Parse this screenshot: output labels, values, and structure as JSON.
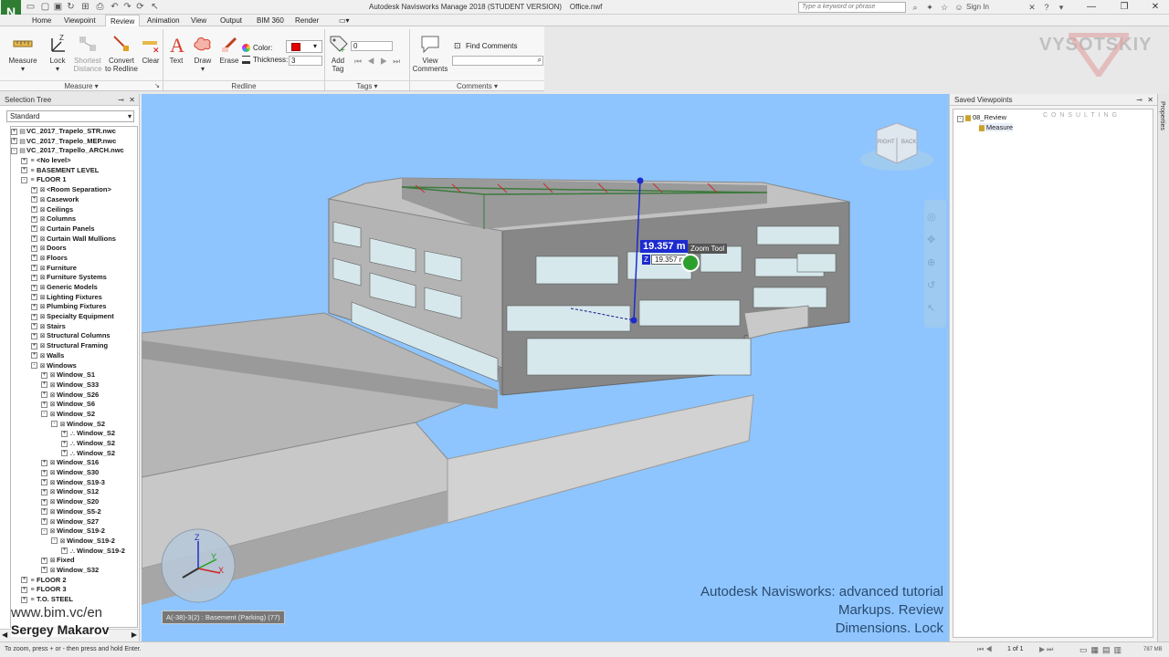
{
  "window": {
    "title": "Autodesk Navisworks Manage 2018 (STUDENT VERSION)    Office.nwf",
    "search_placeholder": "Type a keyword or phrase",
    "signin": "Sign In",
    "app_logo": "N"
  },
  "tabs": [
    "Home",
    "Viewpoint",
    "Review",
    "Animation",
    "View",
    "Output",
    "BIM 360",
    "Render"
  ],
  "active_tab": "Review",
  "ribbon": {
    "measure": {
      "measure": "Measure",
      "lock": "Lock",
      "shortest": "Shortest\nDistance",
      "convert": "Convert\nto Redline",
      "clear": "Clear",
      "panel": "Measure"
    },
    "redline": {
      "text": "Text",
      "draw": "Draw",
      "erase": "Erase",
      "color_label": "Color:",
      "thickness_label": "Thickness:",
      "thickness_value": "3",
      "color": "#e00000",
      "panel": "Redline"
    },
    "tags": {
      "add_tag": "Add\nTag",
      "tag_value": "0",
      "panel": "Tags"
    },
    "comments": {
      "view_comments": "View\nComments",
      "find_comments": "Find Comments",
      "panel": "Comments"
    }
  },
  "selection_tree": {
    "title": "Selection Tree",
    "mode": "Standard",
    "items": [
      {
        "d": 0,
        "t": "VC_2017_Trapelo_STR.nwc",
        "e": "+",
        "g": "file"
      },
      {
        "d": 0,
        "t": "VC_2017_Trapelo_MEP.nwc",
        "e": "+",
        "g": "file"
      },
      {
        "d": 0,
        "t": "VC_2017_Trapello_ARCH.nwc",
        "e": "-",
        "g": "file"
      },
      {
        "d": 1,
        "t": "<No level>",
        "e": "+",
        "g": "level"
      },
      {
        "d": 1,
        "t": "BASEMENT LEVEL",
        "e": "+",
        "g": "level"
      },
      {
        "d": 1,
        "t": "FLOOR 1",
        "e": "-",
        "g": "level"
      },
      {
        "d": 2,
        "t": "<Room Separation>",
        "e": "+",
        "g": "layer"
      },
      {
        "d": 2,
        "t": "Casework",
        "e": "+",
        "g": "layer"
      },
      {
        "d": 2,
        "t": "Ceilings",
        "e": "+",
        "g": "layer"
      },
      {
        "d": 2,
        "t": "Columns",
        "e": "+",
        "g": "layer"
      },
      {
        "d": 2,
        "t": "Curtain Panels",
        "e": "+",
        "g": "layer"
      },
      {
        "d": 2,
        "t": "Curtain Wall Mullions",
        "e": "+",
        "g": "layer"
      },
      {
        "d": 2,
        "t": "Doors",
        "e": "+",
        "g": "layer"
      },
      {
        "d": 2,
        "t": "Floors",
        "e": "+",
        "g": "layer"
      },
      {
        "d": 2,
        "t": "Furniture",
        "e": "+",
        "g": "layer"
      },
      {
        "d": 2,
        "t": "Furniture Systems",
        "e": "+",
        "g": "layer"
      },
      {
        "d": 2,
        "t": "Generic Models",
        "e": "+",
        "g": "layer"
      },
      {
        "d": 2,
        "t": "Lighting Fixtures",
        "e": "+",
        "g": "layer"
      },
      {
        "d": 2,
        "t": "Plumbing Fixtures",
        "e": "+",
        "g": "layer"
      },
      {
        "d": 2,
        "t": "Specialty Equipment",
        "e": "+",
        "g": "layer"
      },
      {
        "d": 2,
        "t": "Stairs",
        "e": "+",
        "g": "layer"
      },
      {
        "d": 2,
        "t": "Structural Columns",
        "e": "+",
        "g": "layer"
      },
      {
        "d": 2,
        "t": "Structural Framing",
        "e": "+",
        "g": "layer"
      },
      {
        "d": 2,
        "t": "Walls",
        "e": "+",
        "g": "layer"
      },
      {
        "d": 2,
        "t": "Windows",
        "e": "-",
        "g": "layer"
      },
      {
        "d": 3,
        "t": "Window_S1",
        "e": "+",
        "g": "layer"
      },
      {
        "d": 3,
        "t": "Window_S33",
        "e": "+",
        "g": "layer"
      },
      {
        "d": 3,
        "t": "Window_S26",
        "e": "+",
        "g": "layer"
      },
      {
        "d": 3,
        "t": "Window_S6",
        "e": "+",
        "g": "layer"
      },
      {
        "d": 3,
        "t": "Window_S2",
        "e": "-",
        "g": "layer"
      },
      {
        "d": 4,
        "t": "Window_S2",
        "e": "-",
        "g": "layer"
      },
      {
        "d": 5,
        "t": "Window_S2",
        "e": "+",
        "g": "geo"
      },
      {
        "d": 5,
        "t": "Window_S2",
        "e": "+",
        "g": "geo"
      },
      {
        "d": 5,
        "t": "Window_S2",
        "e": "+",
        "g": "geo"
      },
      {
        "d": 3,
        "t": "Window_S16",
        "e": "+",
        "g": "layer"
      },
      {
        "d": 3,
        "t": "Window_S30",
        "e": "+",
        "g": "layer"
      },
      {
        "d": 3,
        "t": "Window_S19-3",
        "e": "+",
        "g": "layer"
      },
      {
        "d": 3,
        "t": "Window_S12",
        "e": "+",
        "g": "layer"
      },
      {
        "d": 3,
        "t": "Window_S20",
        "e": "+",
        "g": "layer"
      },
      {
        "d": 3,
        "t": "Window_S5-2",
        "e": "+",
        "g": "layer"
      },
      {
        "d": 3,
        "t": "Window_S27",
        "e": "+",
        "g": "layer"
      },
      {
        "d": 3,
        "t": "Window_S19-2",
        "e": "-",
        "g": "layer"
      },
      {
        "d": 4,
        "t": "Window_S19-2",
        "e": "-",
        "g": "layer"
      },
      {
        "d": 5,
        "t": "Window_S19-2",
        "e": "+",
        "g": "geo"
      },
      {
        "d": 3,
        "t": "Fixed",
        "e": "+",
        "g": "layer"
      },
      {
        "d": 3,
        "t": "Window_S32",
        "e": "+",
        "g": "layer"
      },
      {
        "d": 1,
        "t": "FLOOR 2",
        "e": "+",
        "g": "level"
      },
      {
        "d": 1,
        "t": "FLOOR 3",
        "e": "+",
        "g": "level"
      },
      {
        "d": 1,
        "t": "T.O. STEEL",
        "e": "+",
        "g": "level"
      }
    ]
  },
  "saved_viewpoints": {
    "title": "Saved Viewpoints",
    "items": [
      {
        "d": 0,
        "t": "08_Review"
      },
      {
        "d": 1,
        "t": "Measure"
      }
    ]
  },
  "properties_tab": "Properties",
  "viewport": {
    "measurement": "19.357 m",
    "axis_label": "Z",
    "sub_measurement": "19.357 m",
    "tooltip": "Zoom Tool",
    "location_readout": "A(-38)-3(2) : Basement (Parking) (77)",
    "viewcube_right": "RIGHT",
    "viewcube_back": "BACK",
    "axis_x": "X",
    "axis_y": "Y",
    "axis_z": "Z"
  },
  "overlay": {
    "line1": "Autodesk Navisworks: advanced tutorial",
    "line2": "Markups. Review",
    "line3": "Dimensions. Lock",
    "site": "www.bim.vc/en",
    "author": "Sergey Makarov",
    "wm_brand": "VYSOTSKIY",
    "wm_sub": "C O N S U L T I N G"
  },
  "statusbar": {
    "hint": "To zoom, press + or - then press and hold Enter.",
    "page": "1 of 1",
    "memory": "787 MB"
  }
}
